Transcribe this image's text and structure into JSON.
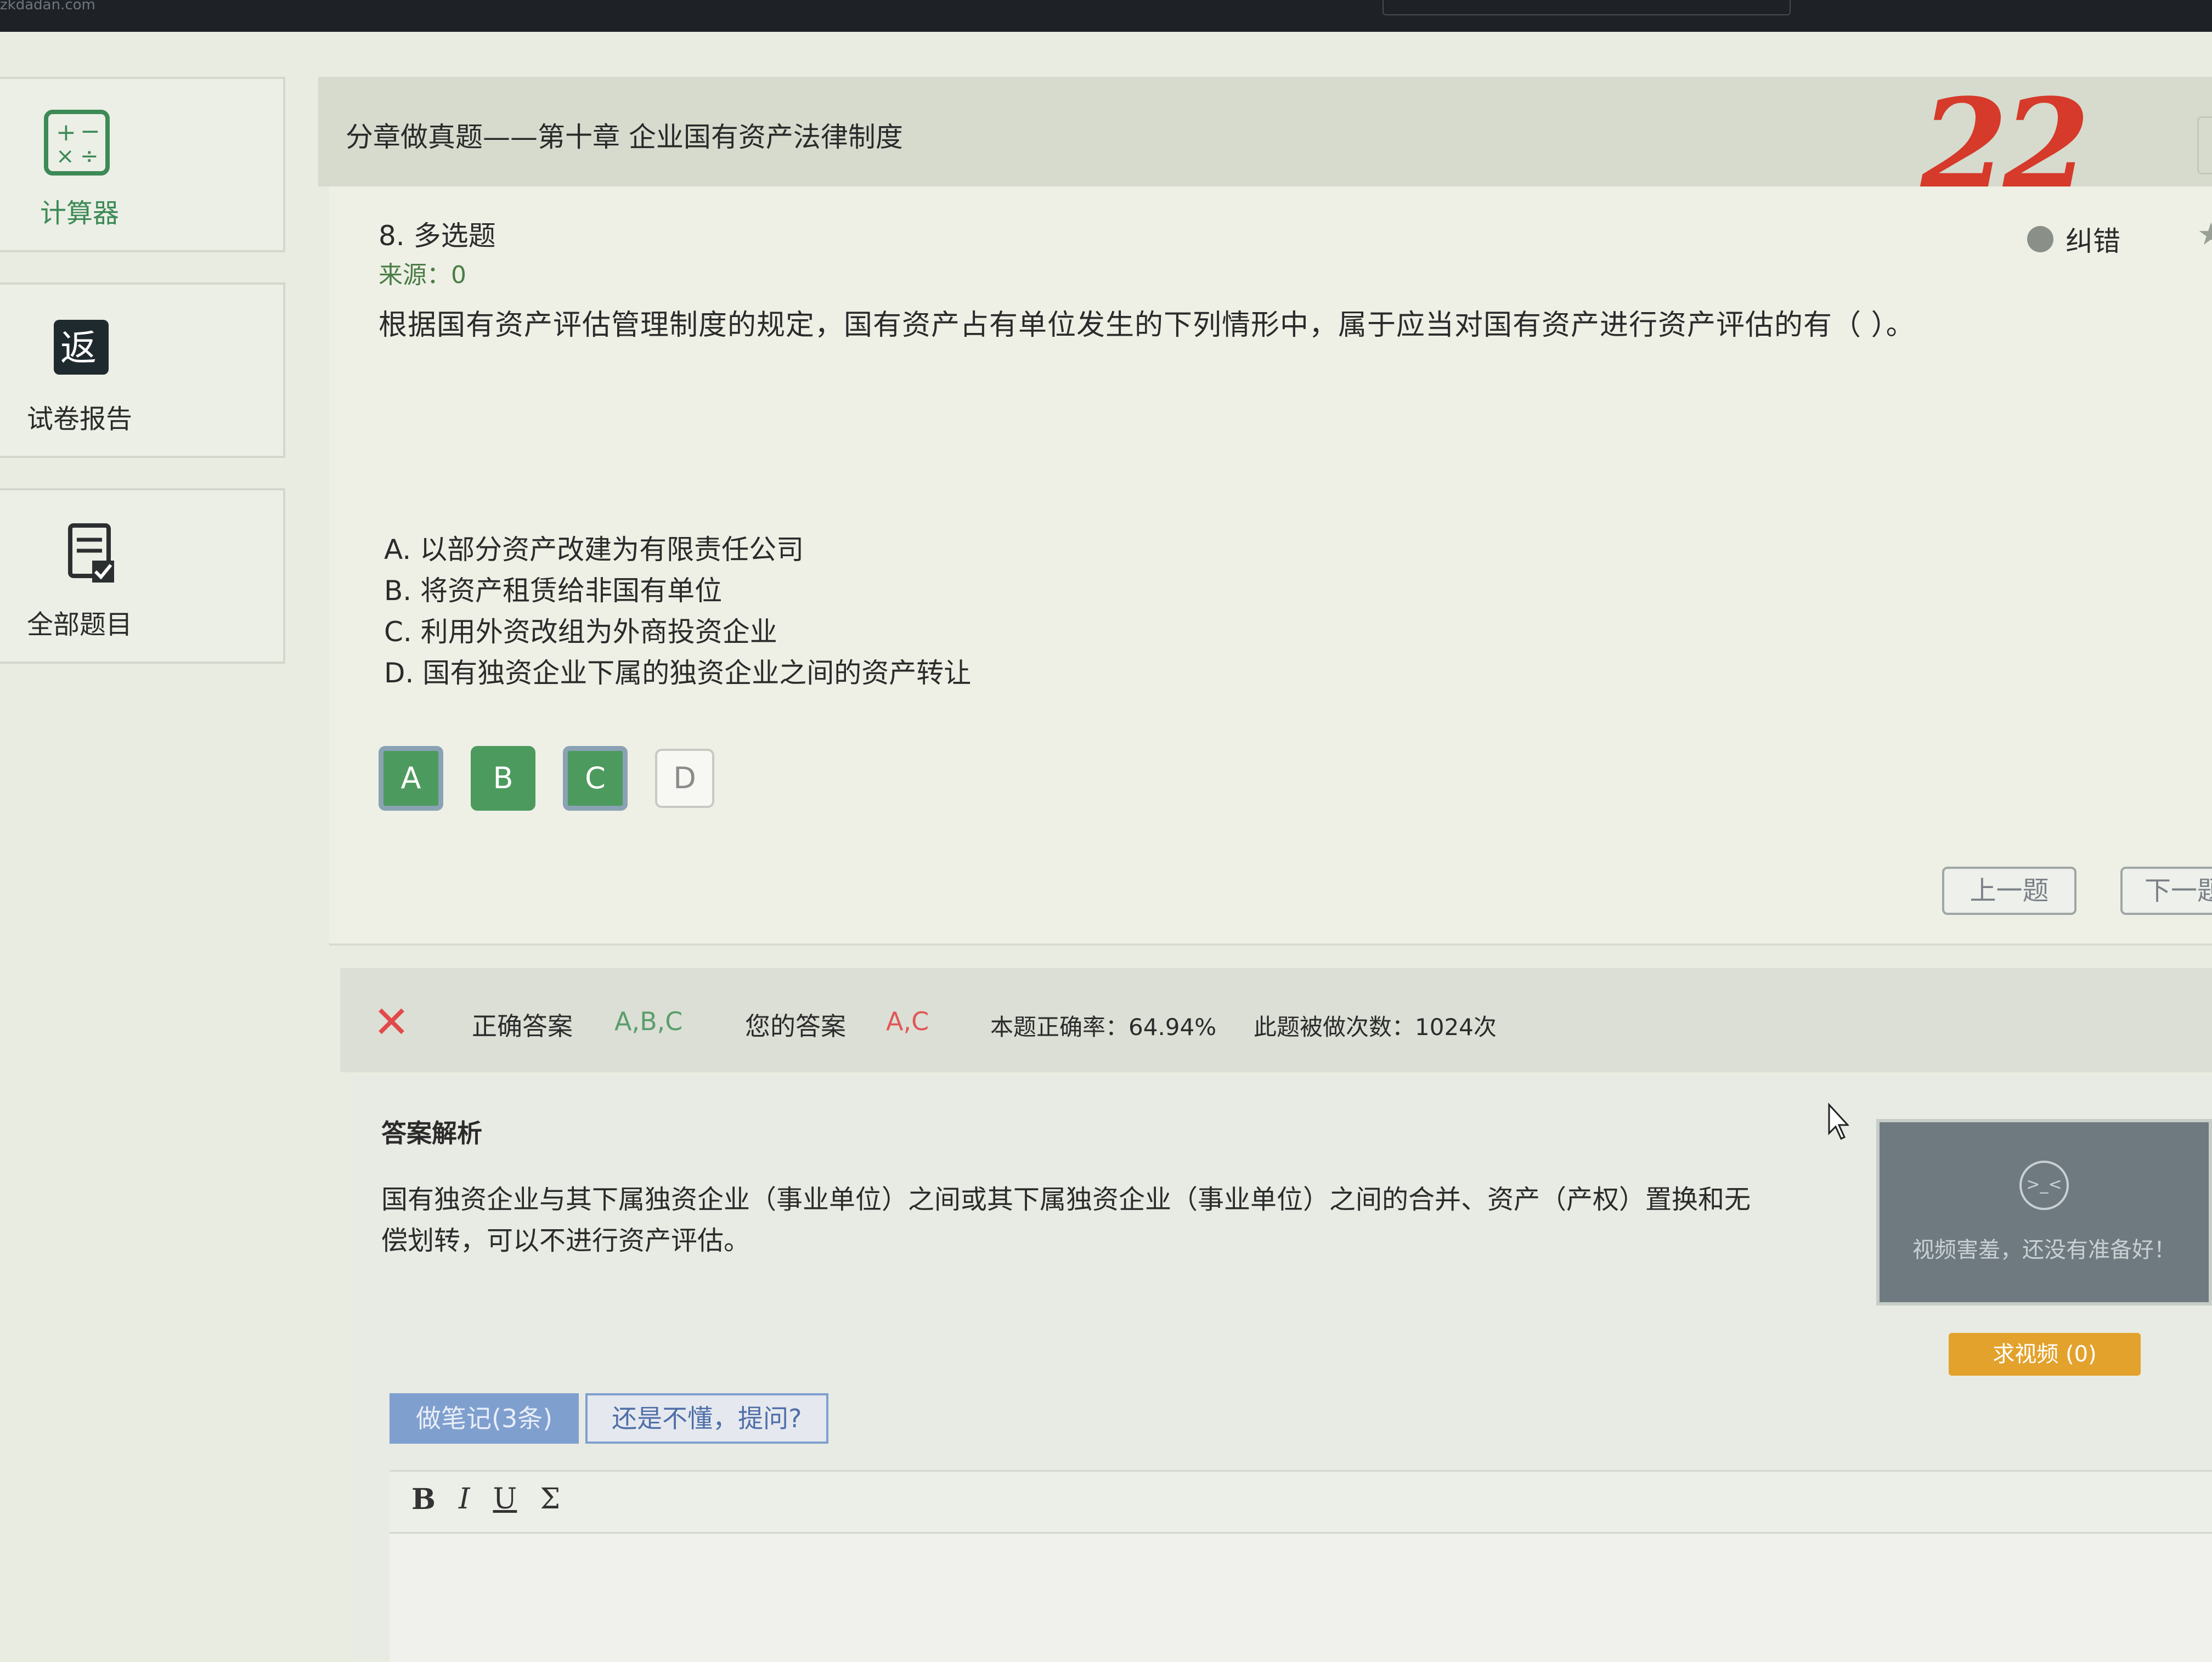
{
  "topbar": {
    "site": "zkdadan.com"
  },
  "sidebar": {
    "calculator": "计算器",
    "report_icon_char": "返",
    "report": "试卷报告",
    "all_questions": "全部题目"
  },
  "header": {
    "title": "分章做真题——第十章 企业国有资产法律制度",
    "handwritten_number": "22"
  },
  "question": {
    "type": "8. 多选题",
    "source": "来源：0",
    "stem": "根据国有资产评估管理制度的规定，国有资产占有单位发生的下列情形中，属于应当对国有资产进行资产评估的有（ ）。",
    "report_error": "纠错",
    "options": [
      "A. 以部分资产改建为有限责任公司",
      "B. 将资产租赁给非国有单位",
      "C. 利用外资改组为外商投资企业",
      "D. 国有独资企业下属的独资企业之间的资产转让"
    ],
    "choice_letters": [
      "A",
      "B",
      "C",
      "D"
    ],
    "prev": "上一题",
    "next": "下一题"
  },
  "answer": {
    "correct_label": "正确答案",
    "correct_value": "A,B,C",
    "yours_label": "您的答案",
    "yours_value": "A,C",
    "rate": "本题正确率：64.94%",
    "count": "此题被做次数：1024次"
  },
  "explanation": {
    "heading": "答案解析",
    "body": "国有独资企业与其下属独资企业（事业单位）之间或其下属独资企业（事业单位）之间的合并、资产（产权）置换和无偿划转，可以不进行资产评估。",
    "video_face": ">_<",
    "video_text": "视频害羞，还没有准备好！",
    "ask_video": "求视频 (0)",
    "notes_tab": "做笔记(3条)",
    "ask_tab": "还是不懂，提问?",
    "toolbar": {
      "bold": "B",
      "italic": "I",
      "underline": "U",
      "sum": "Σ"
    }
  },
  "colors": {
    "accent_green": "#4d9a5e",
    "wrong_red": "#e24a4a",
    "video_orange": "#e3a22c",
    "tab_blue": "#7f9fce"
  }
}
